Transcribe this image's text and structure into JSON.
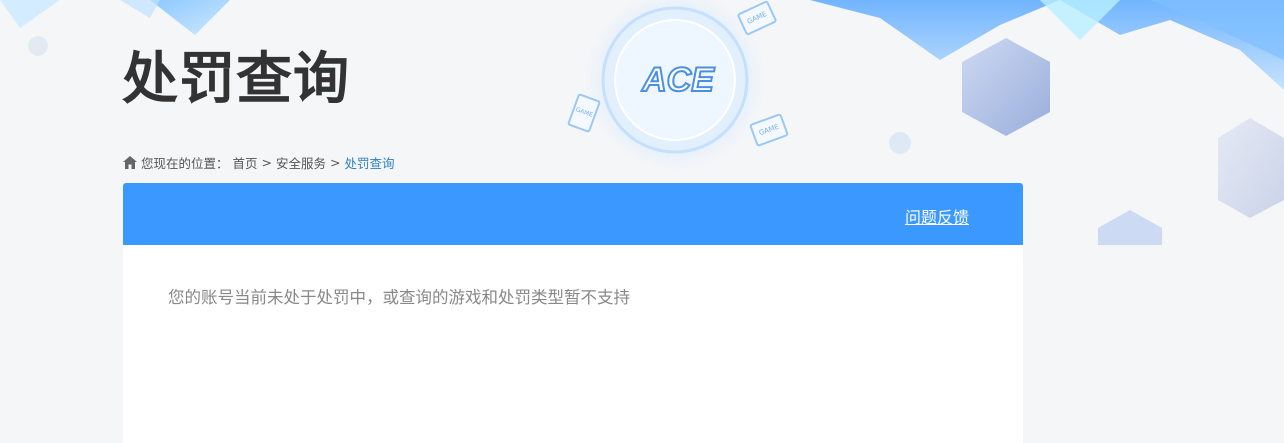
{
  "page": {
    "title": "处罚查询"
  },
  "breadcrumb": {
    "prefix": "您现在的位置：",
    "items": [
      {
        "label": "首页"
      },
      {
        "label": "安全服务"
      },
      {
        "label": "处罚查询"
      }
    ],
    "separator": ">"
  },
  "header_logo": {
    "text": "ACE",
    "badges": [
      "GAME",
      "GAME",
      "GAME"
    ]
  },
  "panel": {
    "header_color": "#3b98fe",
    "feedback_label": "问题反馈",
    "message": "您的账号当前未处于处罚中，或查询的游戏和处罚类型暂不支持"
  },
  "colors": {
    "accent": "#3b98fe",
    "title": "#333333",
    "breadcrumb_current": "#2d7fc1",
    "message": "#888888"
  }
}
